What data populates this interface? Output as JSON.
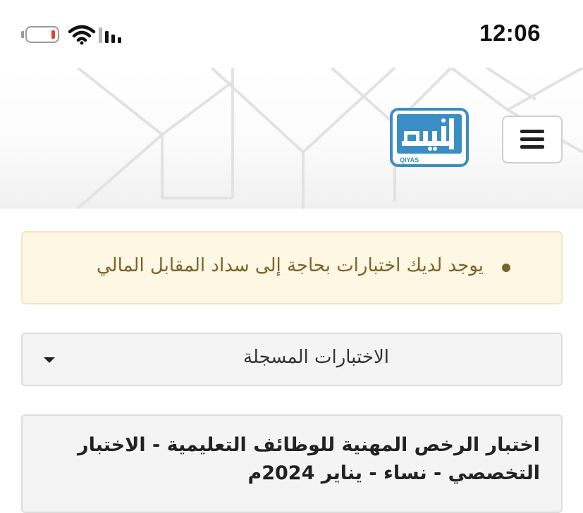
{
  "status_bar": {
    "time": "12:06",
    "battery_color": "#e5402f",
    "icons": [
      "battery-icon",
      "wifi-icon",
      "cellular-signal-icon"
    ]
  },
  "header": {
    "logo_caption": "QIYAS",
    "logo_text": "قياس",
    "logo_color": "#3a8ec4",
    "menu_icon": "hamburger-menu-icon"
  },
  "alert": {
    "message": "يوجد لديك اختبارات بحاجة إلى سداد المقابل المالي",
    "text_color": "#7d6328",
    "background_color": "#fdf7e3"
  },
  "tests_dropdown": {
    "selected": "الاختبارات المسجلة",
    "icon": "caret-down-icon"
  },
  "test_card": {
    "title": "اختبار الرخص المهنية للوظائف التعليمية - الاختبار التخصصي - نساء - يناير 2024م"
  }
}
